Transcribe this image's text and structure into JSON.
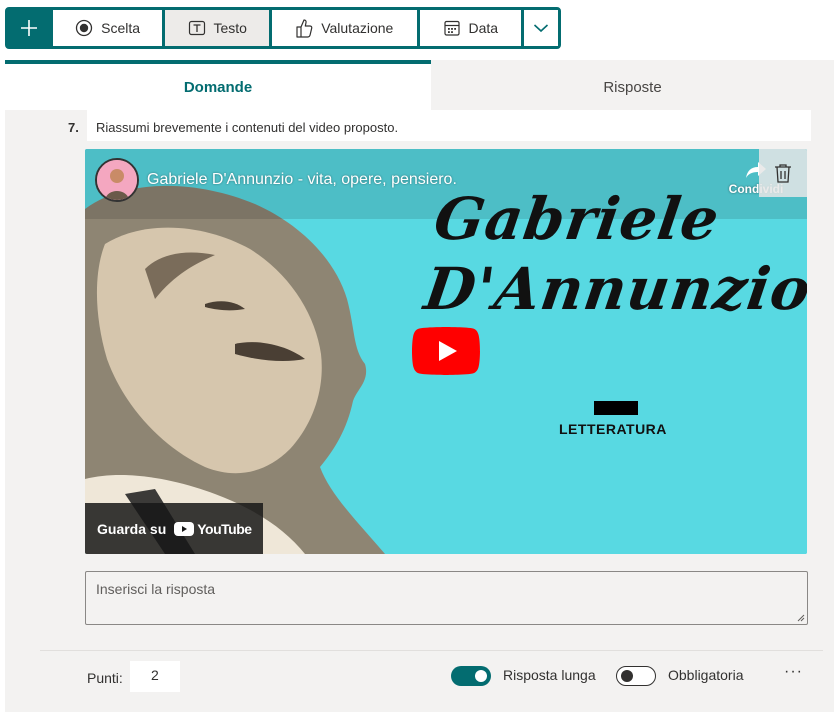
{
  "toolbar": {
    "add_icon": "plus-icon",
    "buttons": [
      {
        "label": "Scelta",
        "icon": "radio-icon"
      },
      {
        "label": "Testo",
        "icon": "text-icon"
      },
      {
        "label": "Valutazione",
        "icon": "thumb-icon"
      },
      {
        "label": "Data",
        "icon": "calendar-icon"
      }
    ],
    "more_icon": "chevron-down-icon"
  },
  "tabs": [
    {
      "label": "Domande",
      "active": true
    },
    {
      "label": "Risposte",
      "active": false
    }
  ],
  "question": {
    "number": "7.",
    "title": "Riassumi brevemente i contenuti del video proposto."
  },
  "video": {
    "title": "Gabriele D'Annunzio - vita, opere, pensiero.",
    "share_label": "Condividi",
    "script_line1": "Gabriele",
    "script_line2": "D'Annunzio",
    "category": "LETTERATURA",
    "watch_label": "Guarda su",
    "youtube_label": "YouTube",
    "colors": {
      "background": "#58d9e2",
      "play": "#ff0000"
    }
  },
  "answer": {
    "placeholder": "Inserisci la risposta"
  },
  "footer": {
    "points_label": "Punti:",
    "points_value": "2",
    "long_answer_label": "Risposta lunga",
    "long_answer_on": true,
    "required_label": "Obbligatoria",
    "required_on": false,
    "more_label": "···"
  },
  "colors": {
    "accent": "#036c70",
    "card": "#f3f2f1"
  }
}
